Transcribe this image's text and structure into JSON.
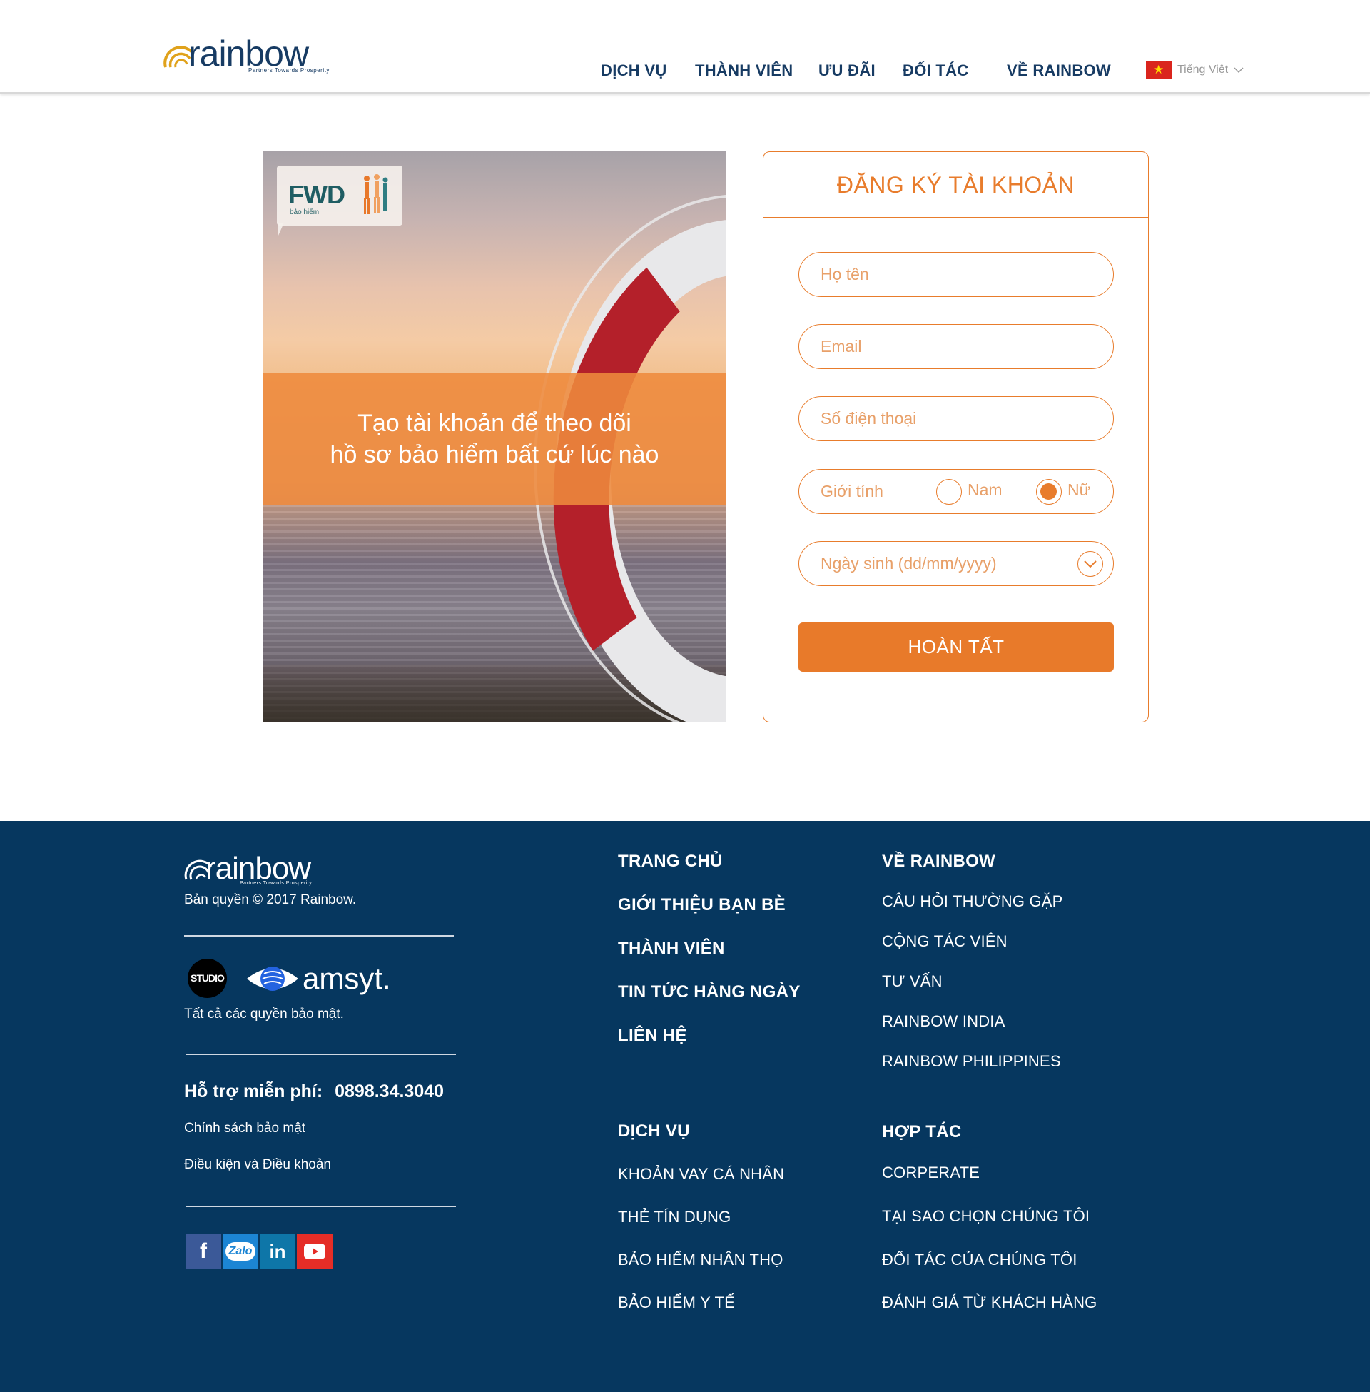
{
  "header": {
    "logo_text": "rainbow",
    "logo_tagline": "Partners Towards Prosperity",
    "nav": [
      "DỊCH VỤ",
      "THÀNH VIÊN",
      "ƯU ĐÃI",
      "ĐỐI TÁC",
      "VỀ RAINBOW"
    ],
    "language": "Tiếng Việt"
  },
  "hero": {
    "partner_logo": "FWD",
    "partner_sub": "bảo hiểm",
    "banner_line1": "Tạo tài khoản để theo dõi",
    "banner_line2": "hồ sơ bảo hiểm bất cứ lúc nào"
  },
  "form": {
    "title": "ĐĂNG KÝ TÀI KHOẢN",
    "name_placeholder": "Họ tên",
    "email_placeholder": "Email",
    "phone_placeholder": "Số điện thoại",
    "gender_label": "Giới tính",
    "gender_options": [
      "Nam",
      "Nữ"
    ],
    "gender_selected": "Nữ",
    "birthday_placeholder": "Ngày sinh (dd/mm/yyyy)",
    "submit_label": "HOÀN TẤT"
  },
  "footer": {
    "logo_text": "rainbow",
    "logo_tagline": "Partners Towards Prosperity",
    "copyright": "Bản quyền © 2017 Rainbow.",
    "studio_label": "STUDIO",
    "amsyt_label": "amsyt.",
    "rights": "Tất cả các quyền bảo mật.",
    "support_label": "Hỗ trợ miễn phí:",
    "support_phone": "0898.34.3040",
    "privacy": "Chính sách bảo mật",
    "terms": "Điều kiện và Điều khoản",
    "social": [
      "facebook",
      "zalo",
      "linkedin",
      "youtube"
    ],
    "social_labels": {
      "zalo": "Zalo",
      "linkedin": "in"
    },
    "col1": [
      "TRANG CHỦ",
      "GIỚI THIỆU BẠN BÈ",
      "THÀNH VIÊN",
      "TIN TỨC HÀNG NGÀY",
      "LIÊN HỆ"
    ],
    "col2_head": "VỀ RAINBOW",
    "col2": [
      "CÂU HỎI THƯỜNG GẶP",
      "CỘNG TÁC VIÊN",
      "TƯ VẤN",
      "RAINBOW INDIA",
      "RAINBOW PHILIPPINES"
    ],
    "col3_head": "DỊCH VỤ",
    "col3": [
      "KHOẢN VAY CÁ NHÂN",
      "THẺ TÍN DỤNG",
      "BẢO HIỂM NHÂN THỌ",
      "BẢO HIỂM Y TẾ"
    ],
    "col4_head": "HỢP TÁC",
    "col4": [
      "CORPERATE",
      "TẠI SAO CHỌN CHÚNG TÔI",
      "ĐỐI TÁC CỦA CHÚNG TÔI",
      "ĐÁNH GIÁ TỪ KHÁCH HÀNG"
    ]
  },
  "colors": {
    "brand_navy": "#173b63",
    "accent_orange": "#e87c2c",
    "footer_bg": "#06375f"
  }
}
